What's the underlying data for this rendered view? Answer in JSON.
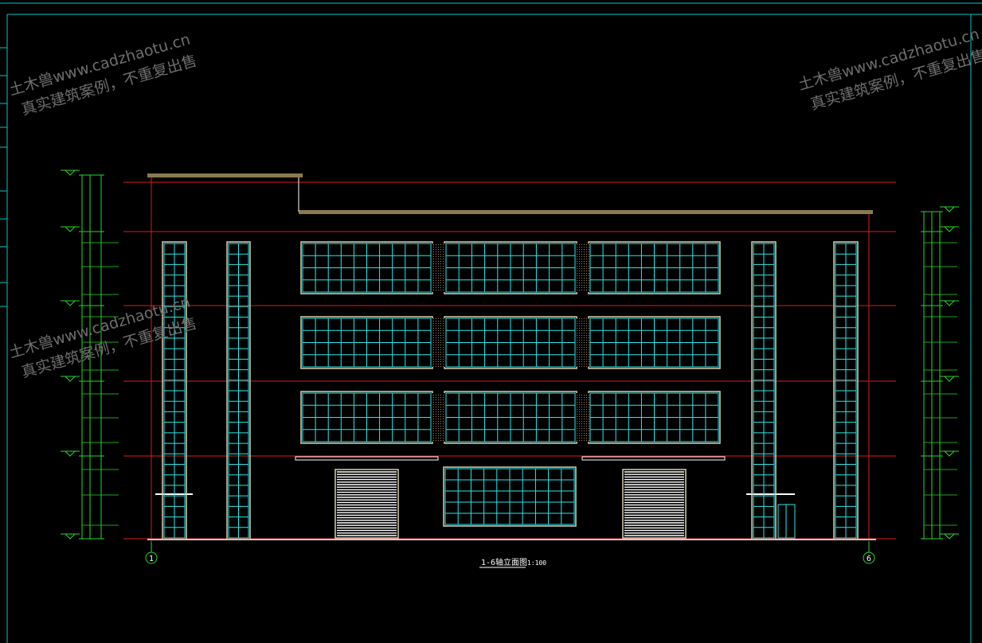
{
  "watermark": {
    "line1": "土木兽www.cadzhaotu.cn",
    "line2": "真实建筑案例，不重复出售"
  },
  "drawing": {
    "axis_left": "1",
    "axis_right": "6",
    "caption_axes": "1-6轴立面图",
    "caption_scale": "1:100"
  },
  "colors": {
    "background": "#000000",
    "frame": "#00c8c8",
    "window_grid": "#2ee6e6",
    "window_frame": "#d8d0b0",
    "floor_line": "#e01818",
    "roof_slab": "#8a7a50",
    "dimension_line": "#28d828",
    "watermark": "#6e6e6e"
  },
  "icons": [
    "axis-bubble-icon",
    "elevation-marker-icon"
  ]
}
